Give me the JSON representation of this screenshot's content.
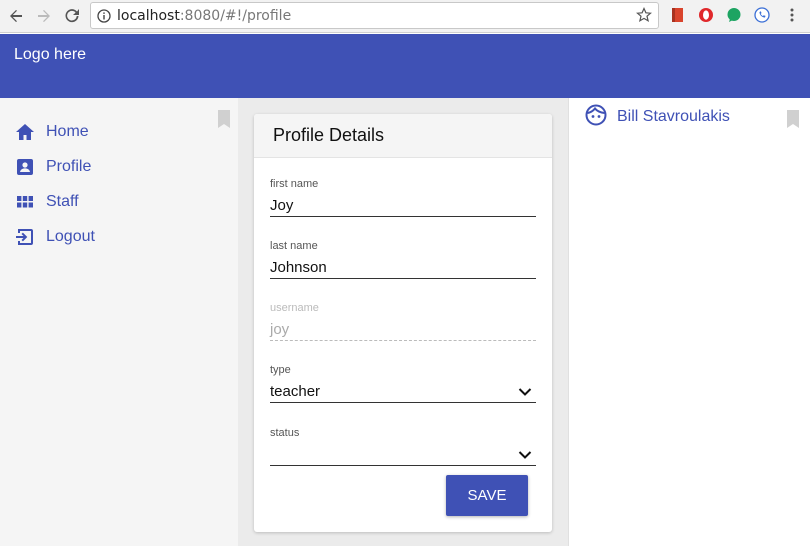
{
  "browser": {
    "url_host": "localhost",
    "url_path": ":8080/#!/profile"
  },
  "app": {
    "logo": "Logo here"
  },
  "sidebar": {
    "items": [
      {
        "label": "Home",
        "icon": "home-icon"
      },
      {
        "label": "Profile",
        "icon": "profile-icon"
      },
      {
        "label": "Staff",
        "icon": "grid-icon"
      },
      {
        "label": "Logout",
        "icon": "logout-icon"
      }
    ]
  },
  "profile": {
    "title": "Profile Details",
    "fields": {
      "first_name": {
        "label": "first name",
        "value": "Joy"
      },
      "last_name": {
        "label": "last name",
        "value": "Johnson"
      },
      "username": {
        "label": "username",
        "value": "joy",
        "disabled": true
      },
      "type": {
        "label": "type",
        "value": "teacher"
      },
      "status": {
        "label": "status",
        "value": ""
      }
    },
    "save_label": "SAVE"
  },
  "user": {
    "name": "Bill Stavroulakis"
  },
  "colors": {
    "primary": "#3f51b5",
    "sidebar_bg": "#f5f5f5",
    "main_bg": "#ebebeb"
  }
}
